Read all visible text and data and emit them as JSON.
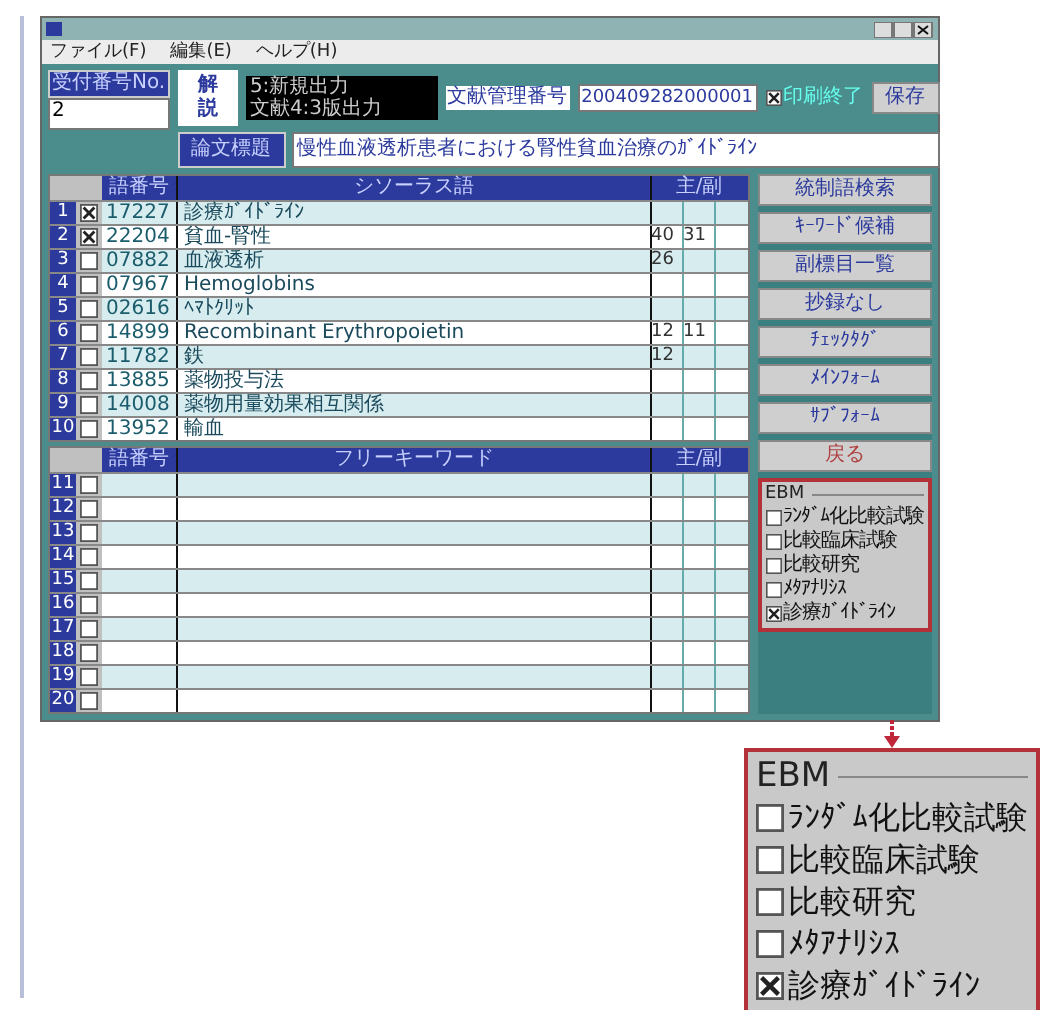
{
  "menu": [
    "ファイル(F)",
    "編集(E)",
    "ヘルプ(H)"
  ],
  "header": {
    "id_label": "受付番号No.",
    "id_value": "2",
    "explain_button": "解説",
    "notes": [
      "5:新規出力",
      "文献4:3版出力"
    ],
    "doc_number_label": "文献管理番号",
    "doc_number": "200409282000001",
    "printed": {
      "label": "印刷終了",
      "checked": true
    },
    "save_button": "保存",
    "title_button": "論文標題",
    "article_title": "慢性血液透析患者における腎性貧血治療のｶﾞｲﾄﾞﾗｲﾝ"
  },
  "thesaurus_table": {
    "columns": [
      "語番号",
      "シソーラス語",
      "主/副"
    ],
    "rows": [
      {
        "no": "1",
        "checked": true,
        "code": "17227",
        "term": "診療ｶﾞｲﾄﾞﾗｲﾝ"
      },
      {
        "no": "2",
        "checked": true,
        "code": "22204",
        "term": "貧血-腎性",
        "main": "40",
        "sub": "31"
      },
      {
        "no": "3",
        "checked": false,
        "code": "07882",
        "term": "血液透析",
        "main": "26"
      },
      {
        "no": "4",
        "checked": false,
        "code": "07967",
        "term": "Hemoglobins"
      },
      {
        "no": "5",
        "checked": false,
        "code": "02616",
        "term": "ﾍﾏﾄｸﾘｯﾄ"
      },
      {
        "no": "6",
        "checked": false,
        "code": "14899",
        "term": "Recombinant Erythropoietin",
        "main": "12",
        "sub": "11"
      },
      {
        "no": "7",
        "checked": false,
        "code": "11782",
        "term": "鉄",
        "main": "12"
      },
      {
        "no": "8",
        "checked": false,
        "code": "13885",
        "term": "薬物投与法"
      },
      {
        "no": "9",
        "checked": false,
        "code": "14008",
        "term": "薬物用量効果相互関係"
      },
      {
        "no": "10",
        "checked": false,
        "code": "13952",
        "term": "輸血"
      }
    ]
  },
  "keyword_table": {
    "columns": [
      "語番号",
      "フリーキーワード",
      "主/副"
    ],
    "rows": [
      {
        "no": "11",
        "checked": false
      },
      {
        "no": "12",
        "checked": false
      },
      {
        "no": "13",
        "checked": false
      },
      {
        "no": "14",
        "checked": false
      },
      {
        "no": "15",
        "checked": false
      },
      {
        "no": "16",
        "checked": false
      },
      {
        "no": "17",
        "checked": false
      },
      {
        "no": "18",
        "checked": false
      },
      {
        "no": "19",
        "checked": false
      },
      {
        "no": "20",
        "checked": false
      }
    ]
  },
  "side_buttons": [
    {
      "label": "統制語検索",
      "kind": "normal"
    },
    {
      "label": "ｷｰﾜｰﾄﾞ候補",
      "kind": "normal"
    },
    {
      "label": "副標目一覧",
      "kind": "normal"
    },
    {
      "label": "抄録なし",
      "kind": "normal"
    },
    {
      "label": "ﾁｪｯｸﾀｸﾞ",
      "kind": "normal"
    },
    {
      "label": "ﾒｲﾝﾌｫｰﾑ",
      "kind": "normal"
    },
    {
      "label": "ｻﾌﾞﾌｫｰﾑ",
      "kind": "normal"
    },
    {
      "label": "戻る",
      "kind": "back"
    }
  ],
  "ebm_panel": {
    "legend": "EBM",
    "options": [
      {
        "label": "ﾗﾝﾀﾞﾑ化比較試験",
        "checked": false
      },
      {
        "label": "比較臨床試験",
        "checked": false
      },
      {
        "label": "比較研究",
        "checked": false
      },
      {
        "label": "ﾒﾀｱﾅﾘｼｽ",
        "checked": false
      },
      {
        "label": "診療ｶﾞｲﾄﾞﾗｲﾝ",
        "checked": true
      }
    ]
  },
  "ebm_inset": {
    "legend": "EBM",
    "options": [
      {
        "label": "ﾗﾝﾀﾞﾑ化比較試験",
        "checked": false
      },
      {
        "label": "比較臨床試験",
        "checked": false
      },
      {
        "label": "比較研究",
        "checked": false
      },
      {
        "label": "ﾒﾀｱﾅﾘｼｽ",
        "checked": false
      },
      {
        "label": "診療ｶﾞｲﾄﾞﾗｲﾝ",
        "checked": true
      }
    ]
  }
}
